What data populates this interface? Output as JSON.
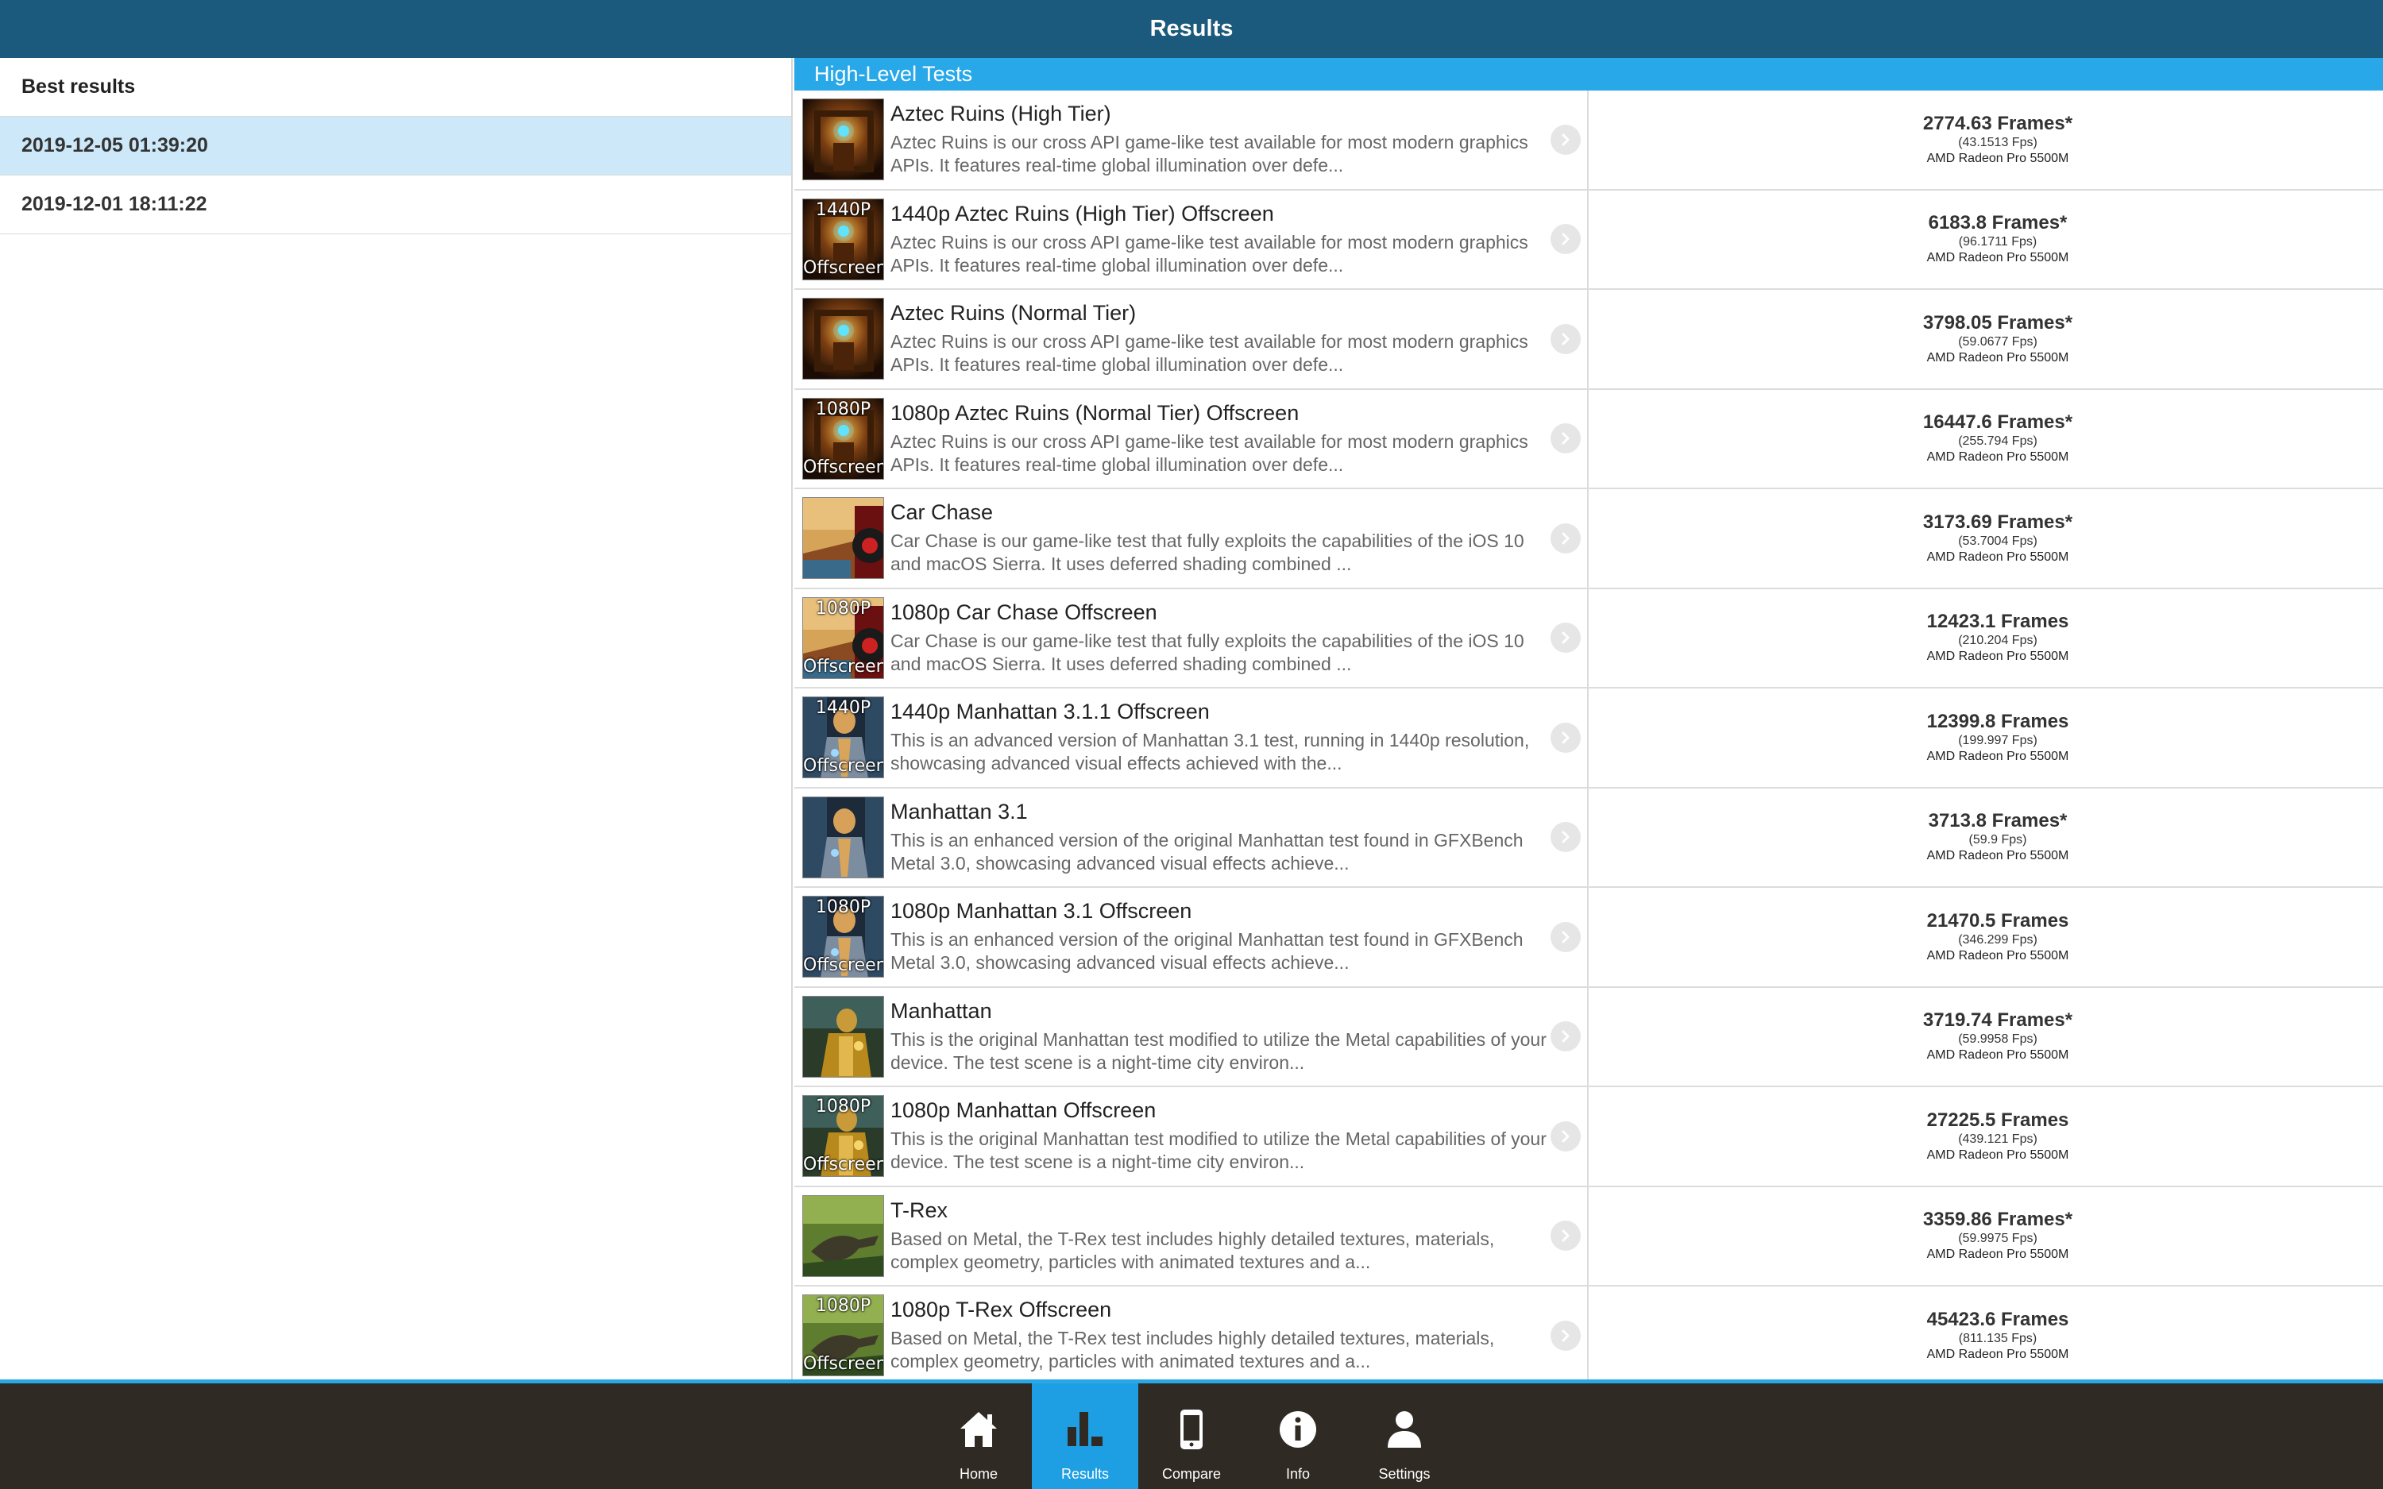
{
  "header": {
    "title": "Results"
  },
  "sidebar": {
    "header": "Best results",
    "items": [
      {
        "label": "2019-12-05 01:39:20",
        "selected": true
      },
      {
        "label": "2019-12-01 18:11:22",
        "selected": false
      }
    ]
  },
  "main": {
    "section_title": "High-Level Tests",
    "tests": [
      {
        "title": "Aztec Ruins (High Tier)",
        "desc": "Aztec Ruins is our cross API game-like test available for most modern graphics APIs. It features real-time global illumination over defe...",
        "score": "2774.63 Frames*",
        "fps": "(43.1513 Fps)",
        "gpu": "AMD Radeon Pro 5500M",
        "thumb": "aztec",
        "badge": ""
      },
      {
        "title": "1440p Aztec Ruins (High Tier) Offscreen",
        "desc": "Aztec Ruins is our cross API game-like test available for most modern graphics APIs. It features real-time global illumination over defe...",
        "score": "6183.8 Frames*",
        "fps": "(96.1711 Fps)",
        "gpu": "AMD Radeon Pro 5500M",
        "thumb": "aztec",
        "badge": "1440P"
      },
      {
        "title": "Aztec Ruins (Normal Tier)",
        "desc": "Aztec Ruins is our cross API game-like test available for most modern graphics APIs. It features real-time global illumination over defe...",
        "score": "3798.05 Frames*",
        "fps": "(59.0677 Fps)",
        "gpu": "AMD Radeon Pro 5500M",
        "thumb": "aztec",
        "badge": ""
      },
      {
        "title": "1080p Aztec Ruins (Normal Tier) Offscreen",
        "desc": "Aztec Ruins is our cross API game-like test available for most modern graphics APIs. It features real-time global illumination over defe...",
        "score": "16447.6 Frames*",
        "fps": "(255.794 Fps)",
        "gpu": "AMD Radeon Pro 5500M",
        "thumb": "aztec",
        "badge": "1080P"
      },
      {
        "title": "Car Chase",
        "desc": "Car Chase is our game-like test that fully exploits the capabilities of the iOS 10 and macOS Sierra. It uses deferred shading combined ...",
        "score": "3173.69 Frames*",
        "fps": "(53.7004 Fps)",
        "gpu": "AMD Radeon Pro 5500M",
        "thumb": "car",
        "badge": ""
      },
      {
        "title": "1080p Car Chase Offscreen",
        "desc": "Car Chase is our game-like test that fully exploits the capabilities of the iOS 10 and macOS Sierra. It uses deferred shading combined ...",
        "score": "12423.1 Frames",
        "fps": "(210.204 Fps)",
        "gpu": "AMD Radeon Pro 5500M",
        "thumb": "car",
        "badge": "1080P"
      },
      {
        "title": "1440p Manhattan 3.1.1 Offscreen",
        "desc": "This is an advanced version of Manhattan 3.1 test, running in 1440p resolution, showcasing advanced visual effects achieved with the...",
        "score": "12399.8 Frames",
        "fps": "(199.997 Fps)",
        "gpu": "AMD Radeon Pro 5500M",
        "thumb": "manhattan31",
        "badge": "1440P"
      },
      {
        "title": "Manhattan 3.1",
        "desc": "This is an enhanced version of the original Manhattan test found in GFXBench Metal 3.0, showcasing advanced visual effects achieve...",
        "score": "3713.8 Frames*",
        "fps": "(59.9 Fps)",
        "gpu": "AMD Radeon Pro 5500M",
        "thumb": "manhattan31",
        "badge": ""
      },
      {
        "title": "1080p Manhattan 3.1 Offscreen",
        "desc": "This is an enhanced version of the original Manhattan test found in GFXBench Metal 3.0, showcasing advanced visual effects achieve...",
        "score": "21470.5 Frames",
        "fps": "(346.299 Fps)",
        "gpu": "AMD Radeon Pro 5500M",
        "thumb": "manhattan31",
        "badge": "1080P"
      },
      {
        "title": "Manhattan",
        "desc": "This is the original Manhattan test modified to utilize the Metal capabilities of your device. The test scene is a night-time city environ...",
        "score": "3719.74 Frames*",
        "fps": "(59.9958 Fps)",
        "gpu": "AMD Radeon Pro 5500M",
        "thumb": "manhattan",
        "badge": ""
      },
      {
        "title": "1080p Manhattan Offscreen",
        "desc": "This is the original Manhattan test modified to utilize the Metal capabilities of your device. The test scene is a night-time city environ...",
        "score": "27225.5 Frames",
        "fps": "(439.121 Fps)",
        "gpu": "AMD Radeon Pro 5500M",
        "thumb": "manhattan",
        "badge": "1080P"
      },
      {
        "title": "T-Rex",
        "desc": "Based on Metal, the T-Rex test includes highly detailed textures, materials, complex geometry, particles with animated textures and a...",
        "score": "3359.86 Frames*",
        "fps": "(59.9975 Fps)",
        "gpu": "AMD Radeon Pro 5500M",
        "thumb": "trex",
        "badge": ""
      },
      {
        "title": "1080p T-Rex Offscreen",
        "desc": "Based on Metal, the T-Rex test includes highly detailed textures, materials, complex geometry, particles with animated textures and a...",
        "score": "45423.6 Frames",
        "fps": "(811.135 Fps)",
        "gpu": "AMD Radeon Pro 5500M",
        "thumb": "trex",
        "badge": "1080P"
      }
    ],
    "offscreen_label": "Offscreen"
  },
  "tabbar": {
    "tabs": [
      {
        "label": "Home",
        "icon": "home-icon",
        "active": false
      },
      {
        "label": "Results",
        "icon": "bar-chart-icon",
        "active": true
      },
      {
        "label": "Compare",
        "icon": "phone-icon",
        "active": false
      },
      {
        "label": "Info",
        "icon": "info-icon",
        "active": false
      },
      {
        "label": "Settings",
        "icon": "user-icon",
        "active": false
      }
    ]
  },
  "colors": {
    "header_bg": "#1b5a7c",
    "section_bg": "#28a8e8",
    "selected_item_bg": "#cce8f9",
    "tabbar_bg": "#2f2a24",
    "tab_active_bg": "#1e9fe3"
  }
}
